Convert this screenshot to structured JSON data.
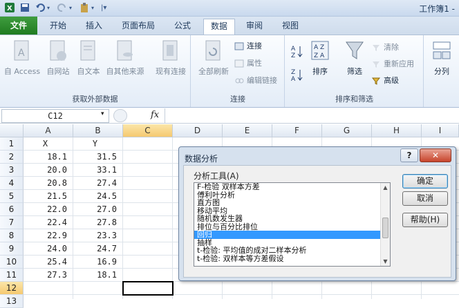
{
  "window": {
    "title": "工作簿1 -"
  },
  "quick_access": {
    "save_icon": "save-icon",
    "undo_icon": "undo-icon",
    "redo_icon": "redo-icon",
    "paste_icon": "paste-icon"
  },
  "tabs": [
    {
      "label": "文件"
    },
    {
      "label": "开始"
    },
    {
      "label": "插入"
    },
    {
      "label": "页面布局"
    },
    {
      "label": "公式"
    },
    {
      "label": "数据"
    },
    {
      "label": "审阅"
    },
    {
      "label": "视图"
    }
  ],
  "ribbon": {
    "get_external": {
      "label": "获取外部数据",
      "buttons": [
        "自 Access",
        "自网站",
        "自文本",
        "自其他来源",
        "现有连接"
      ]
    },
    "connections": {
      "label": "连接",
      "refresh_all": "全部刷新",
      "connect": "连接",
      "properties": "属性",
      "edit_links": "编辑链接"
    },
    "sort_filter": {
      "label": "排序和筛选",
      "sort": "排序",
      "filter": "筛选",
      "clear": "清除",
      "reapply": "重新应用",
      "advanced": "高级"
    },
    "tools": {
      "split": "分列"
    }
  },
  "formula_bar": {
    "name_box": "C12",
    "fx": "fx"
  },
  "sheet": {
    "columns": [
      "A",
      "B",
      "C",
      "D",
      "E",
      "F",
      "G",
      "H",
      "I"
    ],
    "rows": [
      "1",
      "2",
      "3",
      "4",
      "5",
      "6",
      "7",
      "8",
      "9",
      "10",
      "11",
      "12",
      "13"
    ],
    "headers": {
      "A": "X",
      "B": "Y"
    },
    "data": [
      {
        "x": "18.1",
        "y": "31.5"
      },
      {
        "x": "20.0",
        "y": "33.1"
      },
      {
        "x": "20.8",
        "y": "27.4"
      },
      {
        "x": "21.5",
        "y": "24.5"
      },
      {
        "x": "22.0",
        "y": "27.0"
      },
      {
        "x": "22.4",
        "y": "27.8"
      },
      {
        "x": "22.9",
        "y": "23.3"
      },
      {
        "x": "24.0",
        "y": "24.7"
      },
      {
        "x": "25.4",
        "y": "16.9"
      },
      {
        "x": "27.3",
        "y": "18.1"
      }
    ]
  },
  "dialog": {
    "title": "数据分析",
    "help_glyph": "?",
    "close_glyph": "✕",
    "tools_label": "分析工具(A)",
    "items": [
      "F-检验 双样本方差",
      "傅利叶分析",
      "直方图",
      "移动平均",
      "随机数发生器",
      "排位与百分比排位",
      "回归",
      "抽样",
      "t-检验: 平均值的成对二样本分析",
      "t-检验: 双样本等方差假设"
    ],
    "selected_item": "回归",
    "ok": "确定",
    "cancel": "取消",
    "help": "帮助(H)"
  }
}
